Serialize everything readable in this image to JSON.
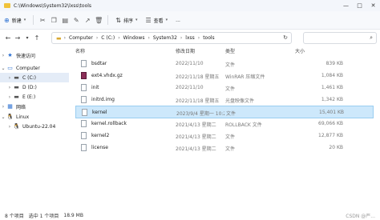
{
  "window": {
    "title": "C:\\Windows\\System32\\lxss\\tools"
  },
  "toolbar": {
    "new_label": "新建",
    "sort_label": "排序",
    "view_label": "查看",
    "more_label": "..."
  },
  "address": {
    "crumbs": [
      "Computer",
      "C (C:)",
      "Windows",
      "System32",
      "lxss",
      "tools"
    ]
  },
  "search": {
    "placeholder": ""
  },
  "sidebar": {
    "items": [
      {
        "label": "快速访问",
        "icon": "star-icon"
      },
      {
        "label": "Computer",
        "icon": "computer-icon"
      },
      {
        "label": "C (C:)",
        "icon": "drive-icon"
      },
      {
        "label": "D (D:)",
        "icon": "drive-icon"
      },
      {
        "label": "E (E:)",
        "icon": "drive-icon"
      },
      {
        "label": "网络",
        "icon": "network-icon"
      },
      {
        "label": "Linux",
        "icon": "linux-icon"
      },
      {
        "label": "Ubuntu-22.04",
        "icon": "linux-icon"
      }
    ]
  },
  "columns": {
    "name": "名称",
    "date": "修改日期",
    "type": "类型",
    "size": "大小"
  },
  "files": [
    {
      "name": "bsdtar",
      "date": "2022/11/10",
      "type": "文件",
      "size": "839 KB"
    },
    {
      "name": "ext4.vhdx.gz",
      "date": "2022/11/18 星期五",
      "type": "WinRAR 压缩文件",
      "size": "1,084 KB"
    },
    {
      "name": "init",
      "date": "2022/11/10",
      "type": "文件",
      "size": "1,461 KB"
    },
    {
      "name": "initrd.img",
      "date": "2022/11/18 星期五",
      "type": "光盘映像文件",
      "size": "1,342 KB"
    },
    {
      "name": "kernel",
      "date": "2023/9/4 星期一 10:20",
      "type": "文件",
      "size": "15,401 KB"
    },
    {
      "name": "kernel.rollback",
      "date": "2021/4/13 星期二",
      "type": "ROLLBACK 文件",
      "size": "69,066 KB"
    },
    {
      "name": "kernel2",
      "date": "2021/4/13 星期二",
      "type": "文件",
      "size": "12,877 KB"
    },
    {
      "name": "license",
      "date": "2021/4/13 星期二",
      "type": "文件",
      "size": "20 KB"
    }
  ],
  "status": {
    "items": "8 个项目",
    "selected": "选中 1 个项目",
    "size": "18.9 MB"
  },
  "watermark": "CSDN @严..."
}
